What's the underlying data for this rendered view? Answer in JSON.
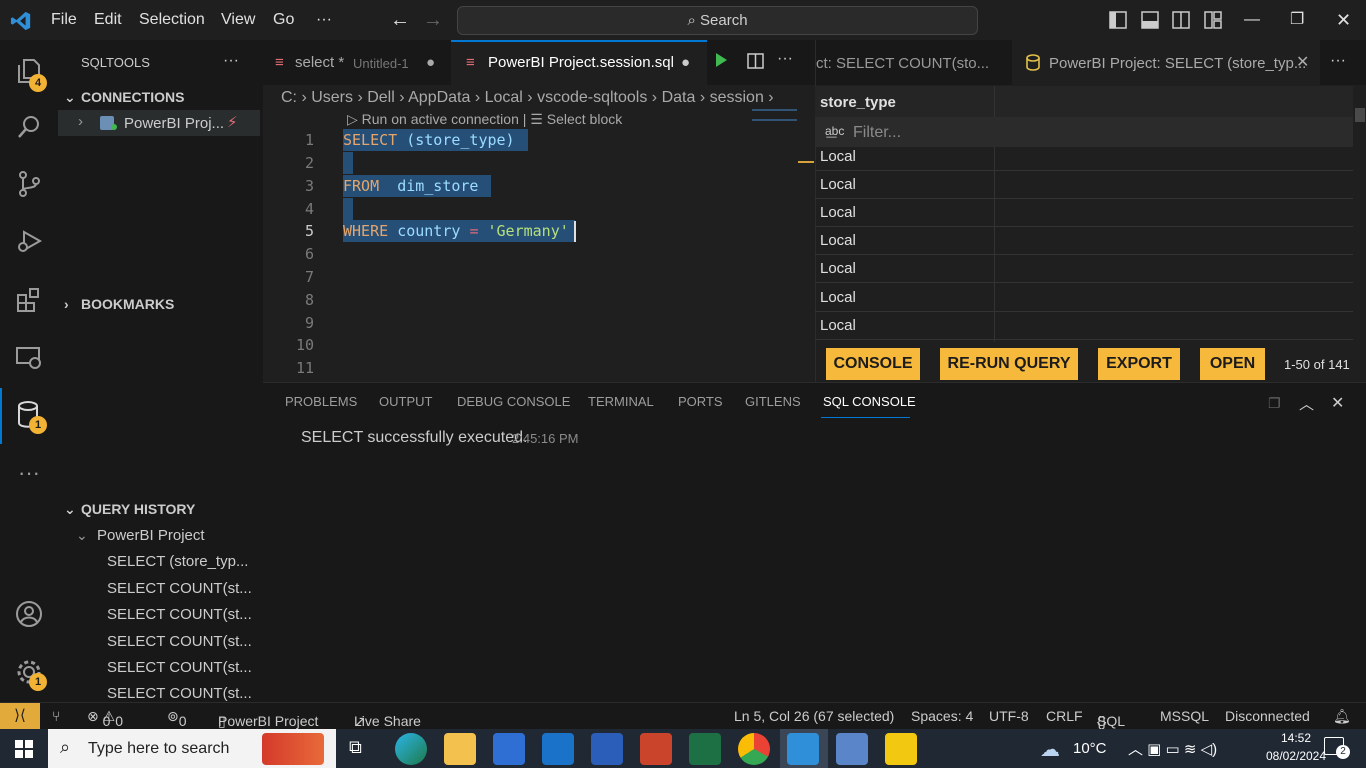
{
  "menu": {
    "file": "File",
    "edit": "Edit",
    "selection": "Selection",
    "view": "View",
    "go": "Go",
    "more": "···"
  },
  "search": {
    "placeholder": "Search"
  },
  "activity": {
    "explorer_badge": "4",
    "sqltools_badge": "1",
    "manage_badge": "1"
  },
  "sidebar": {
    "title": "SQLTOOLS",
    "connections_label": "CONNECTIONS",
    "connection_name": "PowerBI Proj...",
    "bookmarks_label": "BOOKMARKS",
    "history_label": "QUERY HISTORY",
    "history_group": "PowerBI Project",
    "history_items": [
      "SELECT (store_typ...",
      "SELECT COUNT(st...",
      "SELECT COUNT(st...",
      "SELECT COUNT(st...",
      "SELECT COUNT(st...",
      "SELECT COUNT(st..."
    ]
  },
  "tabs": {
    "tab1_name": "select *",
    "tab1_sub": "Untitled-1",
    "tab2_name": "PowerBI Project.session.sql"
  },
  "breadcrumb": [
    "C:",
    "Users",
    "Dell",
    "AppData",
    "Local",
    "vscode-sqltools",
    "Data",
    "session"
  ],
  "codelens": {
    "run": "Run on active connection",
    "select": "Select block"
  },
  "code": {
    "lines": [
      "1",
      "2",
      "3",
      "4",
      "5",
      "6",
      "7",
      "8",
      "9",
      "10",
      "11"
    ],
    "l1_kw": "SELECT",
    "l1_rest": "(store_type)",
    "l3_kw": "FROM",
    "l3_rest": "dim_store",
    "l5_kw": "WHERE",
    "l5_col": "country",
    "l5_op": "=",
    "l5_str": "'Germany'"
  },
  "results": {
    "tab1": "ct: SELECT COUNT(sto...",
    "tab2": "PowerBI Project: SELECT (store_typ...",
    "column": "store_type",
    "filter_placeholder": "Filter...",
    "rows": [
      "Local",
      "Local",
      "Local",
      "Local",
      "Local",
      "Local",
      "Local"
    ],
    "btn_console": "CONSOLE",
    "btn_rerun": "RE-RUN QUERY",
    "btn_export": "EXPORT",
    "btn_open": "OPEN",
    "pagination": "1-50 of 141"
  },
  "panel": {
    "tabs": [
      "PROBLEMS",
      "OUTPUT",
      "DEBUG CONSOLE",
      "TERMINAL",
      "PORTS",
      "GITLENS",
      "SQL CONSOLE"
    ],
    "message": "SELECT successfully executed.",
    "time": "2:45:16 PM"
  },
  "status": {
    "errors": "0",
    "warnings": "0",
    "ports": "0",
    "project": "PowerBI Project",
    "liveshare": "Live Share",
    "position": "Ln 5, Col 26 (67 selected)",
    "spaces": "Spaces: 4",
    "encoding": "UTF-8",
    "eol": "CRLF",
    "lang": "SQL",
    "driver": "MSSQL",
    "conn": "Disconnected"
  },
  "taskbar": {
    "search": "Type here to search",
    "weather": "10°C",
    "time": "14:52",
    "date": "08/02/2024",
    "notif": "2"
  }
}
